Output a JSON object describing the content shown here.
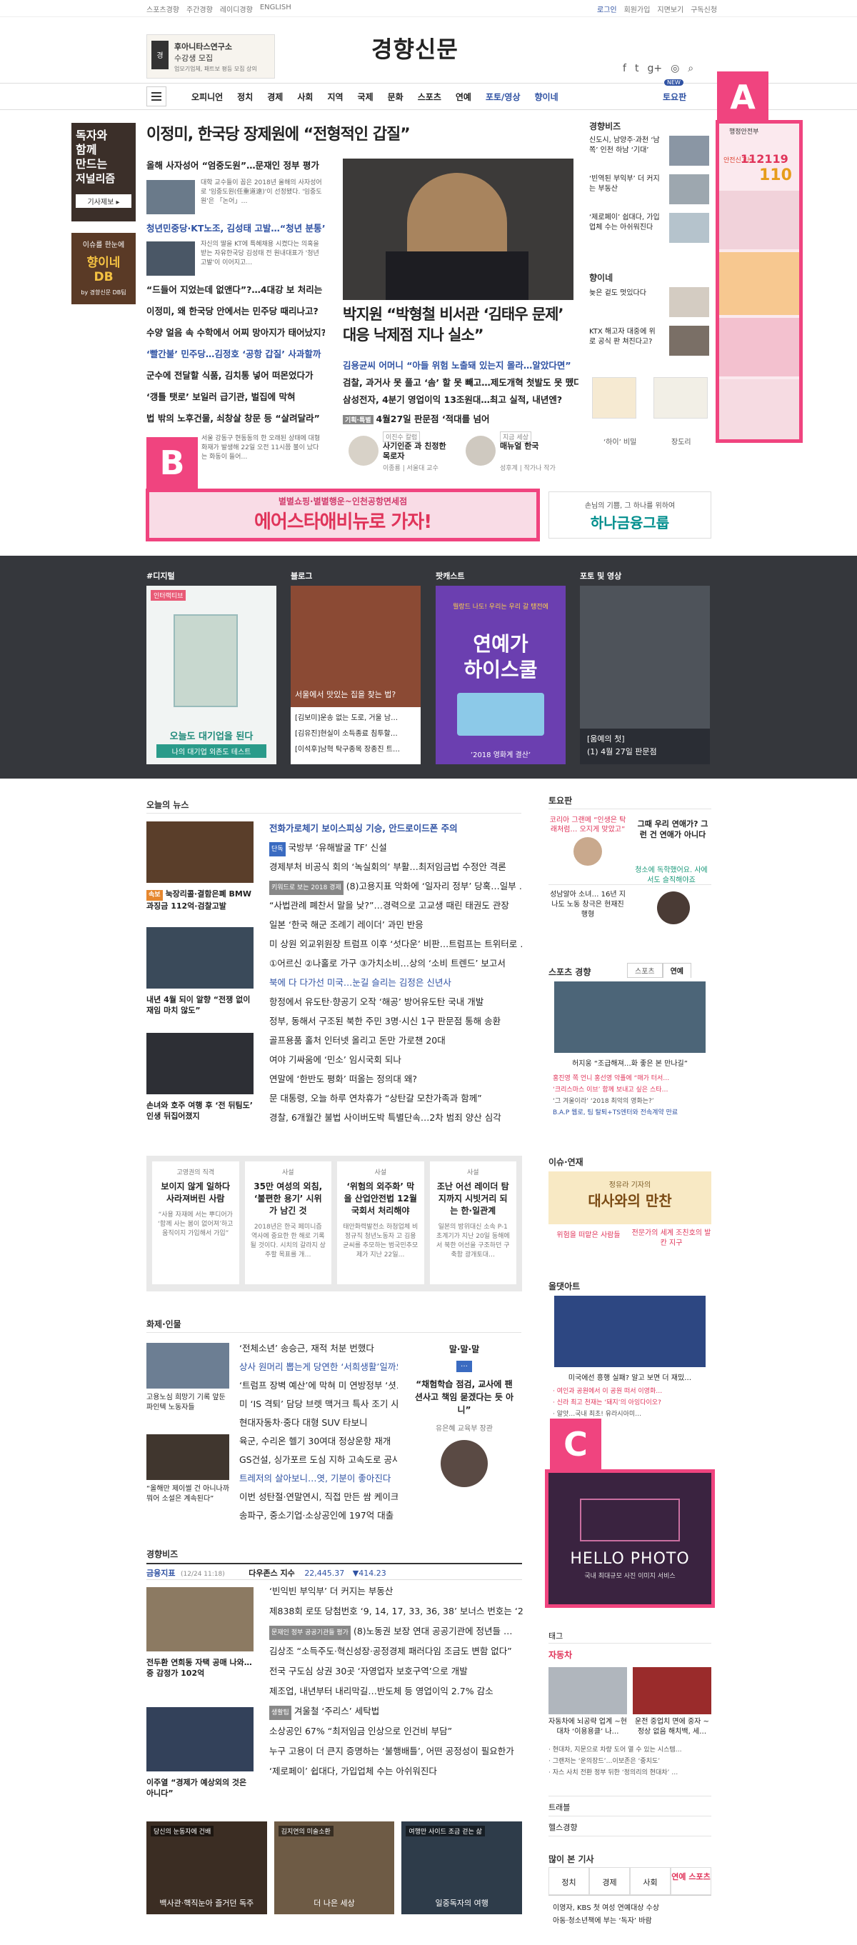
{
  "topbar": {
    "left": [
      "스포츠경향",
      "주간경향",
      "레이디경향",
      "ENGLISH"
    ],
    "right": [
      "로그인",
      "회원가입",
      "지면보기",
      "구독신청"
    ]
  },
  "header": {
    "ad_title": "후아니타스연구소",
    "ad_sub": "수강생 모집",
    "ad_small": "업모기업체, 패트보 평등 모집 상의",
    "logo": "경향신문",
    "social": [
      "f",
      "t",
      "g+",
      "◎",
      "⌕"
    ]
  },
  "nav": {
    "items": [
      "오피니언",
      "정치",
      "경제",
      "사회",
      "지역",
      "국제",
      "문화",
      "스포츠",
      "연예",
      "포토/영상",
      "향이네"
    ],
    "right_label": "토요판",
    "badge": "NEW"
  },
  "left_ads": {
    "ad1": [
      "독자와",
      "함께",
      "만드는",
      "저널리즘"
    ],
    "ad1_btn": "기사제보 ▸",
    "ad2_top": "이슈를 한눈에",
    "ad2_main": [
      "향이네",
      "DB"
    ],
    "ad2_sub": "by 경향신문 DB팀"
  },
  "headline": {
    "title": "이정미, 한국당 장제원에 “전형적인 갑질”"
  },
  "lead_news": [
    {
      "title": "올해 사자성어 “엄중도원”…문재인 정부 평가"
    },
    {
      "caption": "대학 교수들이 꼽은 2018년 올해의 사자성어로 '임중도원(任重道遠)'이 선정됐다. '임중도원'은 「논어」…"
    },
    {
      "title": "청년민중당·KT노조, 김성태 고발…“청년 분통”"
    },
    {
      "caption": "자신의 딸을 KT에 특혜채용 시켰다는 의혹을 받는 자유한국당 김성태 전 원내대표가 '청년 고발'이 이어지고…"
    },
    {
      "title": "“드들어 지었는데 없앤다”?…4대강 보 처리는"
    },
    {
      "title": "이정미, 왜 한국당 안에서는 민주당 때리나고?"
    },
    {
      "title": "수양 얼음 속 수학에서 어찌 망아지가 태어났지?"
    },
    {
      "title": "‘빨간불’ 민주당…김정호 ‘공항 갑질’ 사과할까"
    },
    {
      "title": "군수에 전달할 식품, 김치통 넣어 떠몬었다가"
    },
    {
      "title": "‘갱틀 탯로’ 보일러 급기관, 벌집에 막혀"
    },
    {
      "title": "법 밖의 노후건물, 쇠창살 창문 등 “살려달라”"
    },
    {
      "caption": "서울 강동구 현동동의 한 오래된 상태에 대형 화재가 발생해 22일 오전 11시쯤 불이 났다는 화동이 들어…"
    }
  ],
  "main_story": {
    "title": "박지원 “박형철 비서관 ‘김태우 문제’ 대응 낙제점 지나 실소”",
    "sub_lines": [
      "김용균씨 어머니 “아들 위험 노출돼 있는지 몰라…알았다면”",
      "검찰, 과거사 못 풀고 ‘솜’ 할 못 빼고…제도개혁 첫발도 못 뗐다",
      "삼성전자, 4분기 영업이익 13조원대…최고 실적, 내년엔?"
    ],
    "tag": "기획·특별",
    "tag_text": "4월27일 판문점 ‘적대를 넘어"
  },
  "opinions": [
    {
      "badge": "이진수 칼럼",
      "name": "사기인준 과 친정한 목로자",
      "author": "이종룡 | 서울대 교수"
    },
    {
      "badge": "지금 세상",
      "name": "매뉴얼 한국",
      "author": "성후계 | 작가나 작가"
    }
  ],
  "right_column": {
    "title": "경향비즈",
    "items": [
      {
        "text": "신도시, 남양주·과천 ‘남쪽’ 인천 하남 ‘기대’"
      },
      {
        "text": "‘빈역된 부익부’ 더 커지는 부동산"
      },
      {
        "text": "‘제로페이’ 쉽대다, 가입업체 수는 아쉬워진다"
      }
    ],
    "title2": "향이네",
    "items2": [
      {
        "text": "늦은 겉도 멋있다다"
      },
      {
        "text": "KTX 해고자 대중에 위로 공식 판 쳐진다고?"
      }
    ],
    "cartoons": [
      "‘하이’ 비밀",
      "장도리"
    ]
  },
  "marks": {
    "a": "A",
    "b": "B",
    "c": "C"
  },
  "pink_ad": {
    "label": "행정안전부",
    "num1": "112119",
    "num2": "110",
    "small": "안전신고는"
  },
  "banner": {
    "top": "별별쇼핑·별별행운~인천공항면세점",
    "main": "에어스타애비뉴로 가자!",
    "right_small": "손님의 기쁨, 그 하나를 위하여",
    "right_main": "하나금융그룹"
  },
  "dark_section": {
    "labels": [
      "#디지털",
      "블로그",
      "팟캐스트",
      "포토 및 영상"
    ],
    "card1_badge": "인터랙티브",
    "card1_caption": "오늘도 대기업을 된다",
    "card1_test": "나의 대기업 외존도 테스트",
    "card2_caption": "서울에서 맛있는 집을 찾는 법?",
    "card2_lines": [
      "[김보미]운송 없는 도로, 거울 남…",
      "[김유진]현실이 소득종료 침투할…",
      "[이석후]남혁 탁구종목 장종진 트…"
    ],
    "card3_title": [
      "연예가",
      "하이스쿨"
    ],
    "card3_top": "뭘랑드 나도! 우리는 우리 갈 탱전에",
    "card3_year": "’2018 영화계 결산’",
    "card4_caption": [
      "[움예의 첫]",
      "(1) 4월 27일 판문점"
    ]
  },
  "today_news": {
    "title": "오늘의 뉴스",
    "photos": [
      {
        "badge": "속보",
        "caption": "눅장리콜·결함은폐 BMW 과징금 112억·검찰고발"
      },
      {
        "caption": "내년 4월 되이 알향 “전쟁 없이 재임 마치 않도”"
      },
      {
        "caption": "손녀와 호주 여행 후 ‘전 뒤팀도’ 인생 뒤집어졌지"
      }
    ],
    "lines": [
      {
        "text": "전화가로체기 보이스피싱 기승, 안드로이드폰 주의",
        "color": "#2f52a3",
        "bold": true
      },
      {
        "text": "국방부 ‘유해발굴 TF’ 신설",
        "badge": "단독"
      },
      {
        "text": "경제부처 비공식 회의 ‘녹실회의’ 부활…최저임금법 수정안 격론"
      },
      {
        "text": "(8)고용지표 악화에 ‘일자리 정부’ 당혹…일부 …",
        "badge": "키워드로 보는 2018 경제",
        "badge_gray": true
      },
      {
        "text": "“사법관례 폐찬서 말을 낮?”…경력으로 고교생 때린 태권도 관장"
      },
      {
        "text": "일본 ‘한국 해군 조례기 레이더’ 과민 반응"
      },
      {
        "text": "미 상원 외교위원장 트럼프 이후 ‘섯다운’ 비판…트럼프는 트위터로 …"
      },
      {
        "text": "①어르신 ②나홀로 가구 ③가치소비…상의 ‘소비 트렌드’ 보고서"
      },
      {
        "text": "북에 다 다가선 미국…눈길 슬리는 김정은 신년사",
        "color": "#2f52a3"
      },
      {
        "text": "항정에서 유도탄·향공기 오작 ‘해공’ 방어유도탄 국내 개발"
      },
      {
        "text": "정부, 동해서 구조된 북한 주민 3명·시신 1구 판문점 통해 송환"
      },
      {
        "text": "골프용품 홀처 인터넷 올리고 돈만 가로챈 20대"
      },
      {
        "text": "여야 기싸움에 ‘민소’ 임시국회 되나"
      },
      {
        "text": "연말에 ‘한반도 평화’ 떠올는 정의대 왜?"
      },
      {
        "text": "문 대통령, 오늘 하루 연차휴가 “상탄갈 모찬가족과 함께”"
      },
      {
        "text": "경찰, 6개월간 불법 사이버도박 특별단속…2차 범죄 양산 심각"
      }
    ]
  },
  "editorials": [
    {
      "tag": "고영권의 직격",
      "title": "보이지 않게 일하다 사라져버린 사람",
      "text": "“사용 자재에 서는 뿌디어가 ‘함께 사는 봄이 없어져’하고 움직이지 가입해서 가입”"
    },
    {
      "tag": "사설",
      "title": "35만 여성의 외침, ‘불편한 용기’ 시위가 남긴 것",
      "text": "2018년은 한국 페미니즘 역사에 중요한 한 해로 기록될 것이다. 시치의 갈라지 상주할 목표를 개…"
    },
    {
      "tag": "사설",
      "title": "‘위험의 외주화’ 막을 산업안전법 12월 국회서 처리해야",
      "text": "태안화력발전소 하청업체 비정규직 청년노동자 고 김용균씨를 추모하는 범국민추모제가 지난 22일…"
    },
    {
      "tag": "사설",
      "title": "조난 어선 레이더 탐지까지 시빗거리 되는 한·일관계",
      "text": "일본의 방위대신 소속 P-1 초계기가 지난 20일 동해에서 북한 어선을 구조하던 구축함 광개토대…"
    }
  ],
  "issue_people": {
    "title": "화제·인물",
    "photos": [
      {
        "caption": "고용노심 희망기 기록 앞둔 파인텍 노동자들"
      },
      {
        "caption": "“올해만 제이썰 건 아니나까 뭐어 소설은 계속된다”"
      }
    ],
    "lines": [
      {
        "text": "‘전체소년’ 송승근, 재적 처분 번했다"
      },
      {
        "text": "상사 원머리 뽑는게 당연한 ‘서희생활’일까요",
        "color": "#2f52a3"
      },
      {
        "text": "‘트럼프 장벽 예산’에 막혀 미 연방정부 ‘셧…"
      },
      {
        "text": "미 ‘IS 격퇴’ 담당 브렛 맥거크 특사 조기 사퇴"
      },
      {
        "text": "현대자동차·중다 대형 SUV 타보니"
      },
      {
        "text": "육군, 수리온 헬기 30여대 정상운항 재개"
      },
      {
        "text": "GS건설, 싱가포르 도심 지하 고속도로 공사 …"
      },
      {
        "text": "트레저의 살아보니…엿, 기분이 좋아진다",
        "color": "#2f52a3"
      },
      {
        "text": "이번 성탄절·연말연시, 직접 만든 쌈 케이크 …"
      },
      {
        "text": "송파구, 중소기업·소상공인에 197억 대출"
      }
    ],
    "quote_title": "말·말·말",
    "quote": "“채험학습 점검, 교사에 팬션사고 책임 묻겠다는 듯 아니”",
    "quote_author": "유은혜 교육부 장관"
  },
  "biz": {
    "title": "경향비즈",
    "index_label": "금융지표",
    "index_date": "(12/24 11:18)",
    "index_name": "다우존스 지수",
    "index_value": "22,445.37",
    "index_change": "▼414.23",
    "photos": [
      {
        "caption": "전두환 연희동 자택 공매 나와…중 감정가 102억"
      },
      {
        "caption": "이주열 “경제가 예상외의 것은 아니다”"
      }
    ],
    "lines": [
      {
        "text": "‘빈익빈 부익부’ 더 커지는 부동산"
      },
      {
        "text": "제838회 로또 당첨번호 ‘9, 14, 17, 33, 36, 38’ 보너스 번호는 ‘20’"
      },
      {
        "text": "(8)노동권 보장 연대 공공기관에 정년들 …",
        "badge": "문재인 정부 공공기관들 평가",
        "badge_gray": true
      },
      {
        "text": "김상조 “소득주도·혁신성장·공정경제 패러다임 조금도 변함 없다”"
      },
      {
        "text": "전국 구도심 상권 30곳 ‘자영업자 보호구역’으로 개발"
      },
      {
        "text": "제조업, 내년부터 내리막길…반도체 등 영업이익 2.7% 감소"
      },
      {
        "text": "겨울철 ‘주리스’ 세탁법",
        "badge": "생활팁",
        "badge_gray": true
      },
      {
        "text": "소상공인 67% “최저임금 인상으로 인건비 부담”"
      },
      {
        "text": "누구 고용이 더 큰지 증명하는 ‘불행배틀’, 어떤 공정성이 필요한가"
      },
      {
        "text": "‘제로페이’ 쉽대다, 가입업체 수는 아쉬워진다"
      }
    ]
  },
  "bottom_cards": [
    {
      "tag": "당신의 눈동자에 건배",
      "caption": "백사관·핵직눈아 즐거던 독주"
    },
    {
      "tag": "김지연의 미술소환",
      "caption": "더 나은 세상"
    },
    {
      "tag": "여행만 사이드 조금 걷는 삶",
      "caption": "일중독자의 여행"
    }
  ],
  "sidebar": {
    "today_title": "토요판",
    "today_items": [
      {
        "pink": "코리아 그랜메 “인생은 탁래처럼… 오지게 맞았고”",
        "text": "그때 우리 연애가? 그런 건 연애가 아니다"
      },
      {
        "text": "성남알아 소녀… 16년 지나도 노동 창극은 현재진행형",
        "green": "청소에 독학했어요. 사에서도 슬직해야죠"
      }
    ],
    "sports_title": "스포츠 경향",
    "sports_tabs": [
      "스포츠",
      "연예"
    ],
    "sports_caption": "허지웅 “조급해져…화 좋은 본 만나길”",
    "sports_lines": [
      "홍진영 쪽 언니 홍선영 악플에 “매가 터서…",
      "‘크리스마스 이브’ 함께 보내고 싶은 스타…",
      "‘그 겨울이라’ ‘2018 최악의 영화는?’",
      "B.A.P 웹로, 팀 탈퇴+TS엔터와 전속계약 만료"
    ],
    "issue_title": "이슈·연재",
    "issue_banner_top": "정유라 기자의",
    "issue_banner_main": "대사와의 만찬",
    "issue_items": [
      "위험을 떠맡은 사람들",
      "전문가의 세계 조친호의 발칸 지구"
    ],
    "dart_title": "올댓아트",
    "dart_caption": "미국에선 흥행 실패? 알고 보면 더 재밌…",
    "dart_lines": [
      "· 여인과 공원에서 이 공원 떠서 이영화…",
      "· 신라 최고 천재는 ‘돼지’의 아잉다이오?",
      "· 알앗…국내 최초! 유라시아미…"
    ],
    "photo_ad_main": "HELLO PHOTO",
    "photo_ad_sub": "국내 최대규모 사진 이미지 서비스",
    "tag_title": "태그",
    "car_title": "자동차",
    "car_captions": [
      "자동차에 뇌공략 업계 ~현대차 ‘이용용클’ 나…",
      "운전 중업치 면에 중자 ~정상 없음 해치백, 세…"
    ],
    "car_lines": [
      "· 현대차, 지문으로 차량 도어 열 수 있는 시스템…",
      "· 그랜저는 ‘운의장드’…이보존은 ‘중치도’",
      "· 자스 사치 전환 정부 뒤한 ‘정의리의 현대차’ …"
    ],
    "trail_title": "트래블",
    "health_title": "헬스경향",
    "most_title": "많이 본 기사",
    "most_tabs": [
      "정치",
      "경제",
      "사회",
      "연예 스포츠"
    ],
    "most_items": [
      "이영자, KBS 첫 여성 연예대상 수상",
      "아동·청소년책에 부는 ‘독자’ 바람"
    ]
  }
}
